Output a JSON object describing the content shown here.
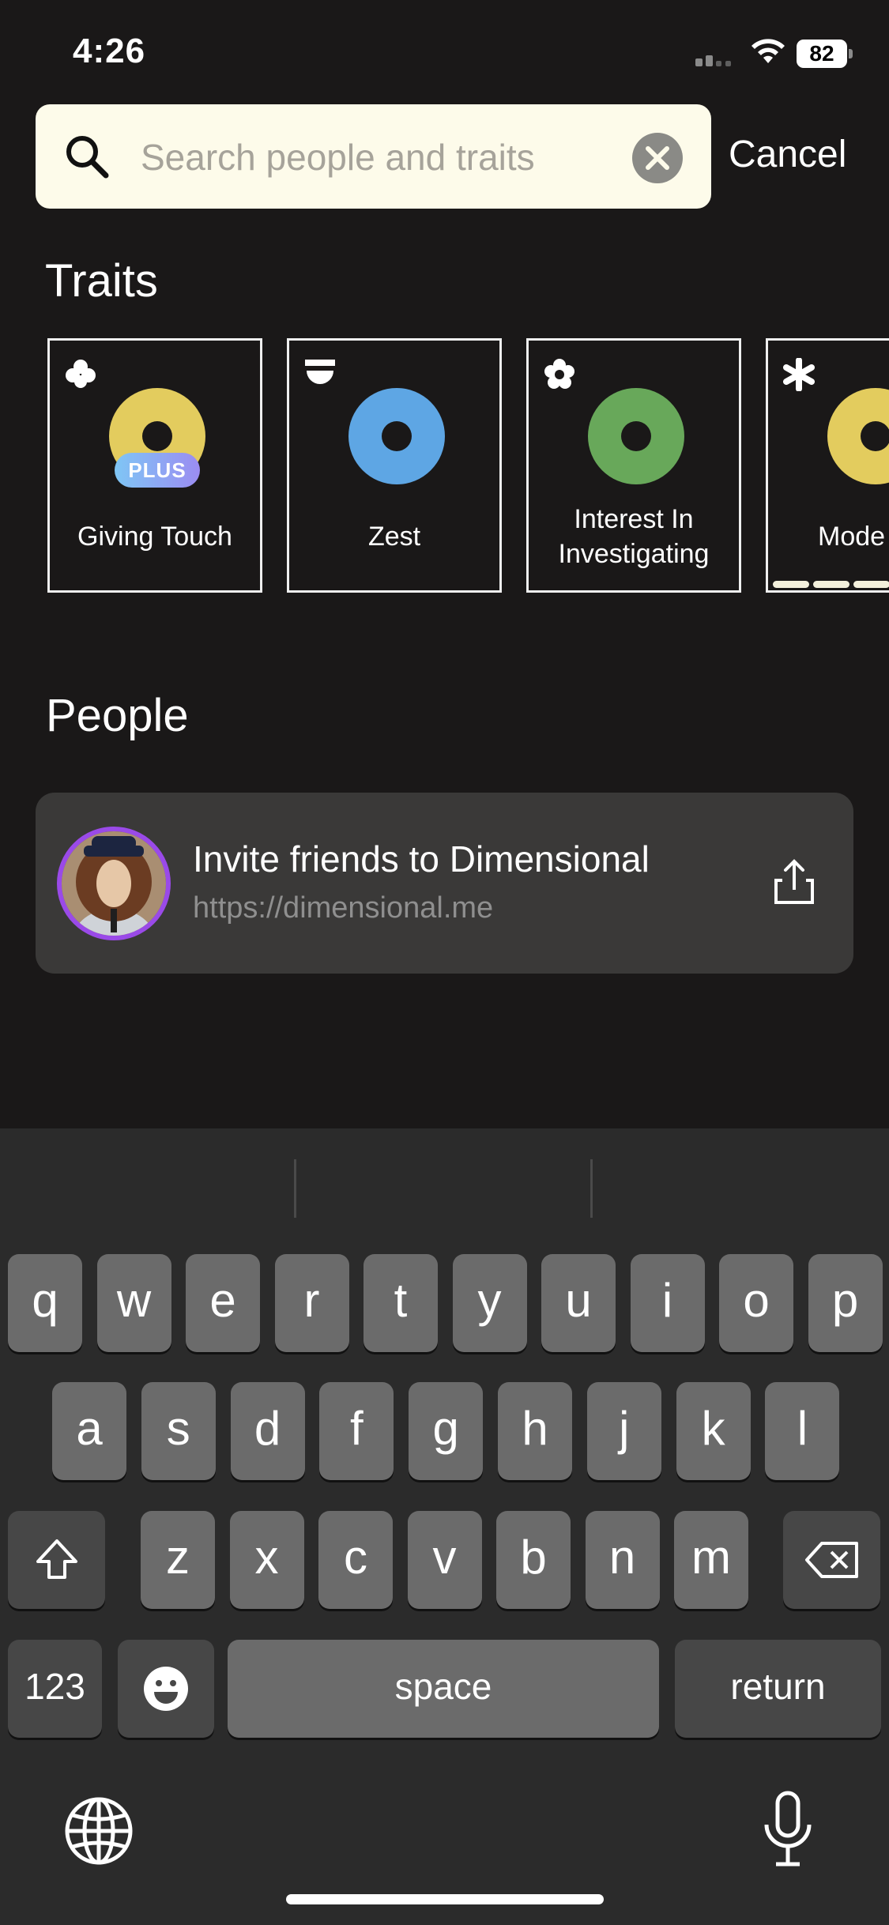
{
  "status_bar": {
    "time": "4:26",
    "battery": "82"
  },
  "search": {
    "placeholder": "Search people and traits",
    "value": "",
    "cancel_label": "Cancel"
  },
  "traits": {
    "heading": "Traits",
    "cards": [
      {
        "label": "Giving Touch",
        "color": "#e3cc5e",
        "icon": "clover-icon",
        "badge": "PLUS"
      },
      {
        "label": "Zest",
        "color": "#5ea6e4",
        "icon": "half-circle-icon"
      },
      {
        "label": "Interest In Investigating",
        "label_lines": [
          "Interest In",
          "Investigating"
        ],
        "color": "#68a85a",
        "icon": "flower-icon"
      },
      {
        "label": "Mode",
        "color": "#e3cc5e",
        "icon": "asterisk-icon"
      }
    ]
  },
  "people": {
    "heading": "People",
    "invite_title": "Invite friends to Dimensional",
    "invite_url": "https://dimensional.me"
  },
  "keyboard": {
    "row1": [
      "q",
      "w",
      "e",
      "r",
      "t",
      "y",
      "u",
      "i",
      "o",
      "p"
    ],
    "row2": [
      "a",
      "s",
      "d",
      "f",
      "g",
      "h",
      "j",
      "k",
      "l"
    ],
    "row3": [
      "z",
      "x",
      "c",
      "v",
      "b",
      "n",
      "m"
    ],
    "numbers_label": "123",
    "space_label": "space",
    "return_label": "return"
  }
}
